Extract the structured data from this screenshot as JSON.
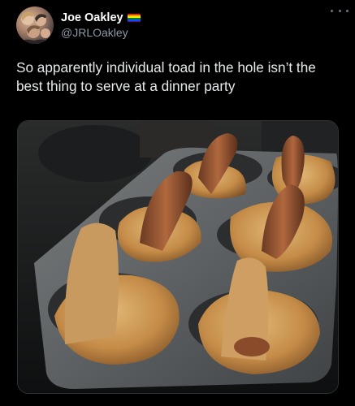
{
  "author": {
    "name": "Joe Oakley",
    "handle": "@JRLOakley",
    "flag_colors": [
      "#e40303",
      "#ff8c00",
      "#ffed00",
      "#008026",
      "#004dff",
      "#750787"
    ]
  },
  "tweet": {
    "text": "So apparently individual toad in the hole isn’t the best thing to serve at a dinner party"
  },
  "icons": {
    "more": "more-horizontal-icon",
    "avatar": "group-photo-avatar"
  },
  "colors": {
    "background": "#000000",
    "text": "#e7e9ea",
    "secondary_text": "#8b98a5",
    "border": "#2f3336"
  }
}
